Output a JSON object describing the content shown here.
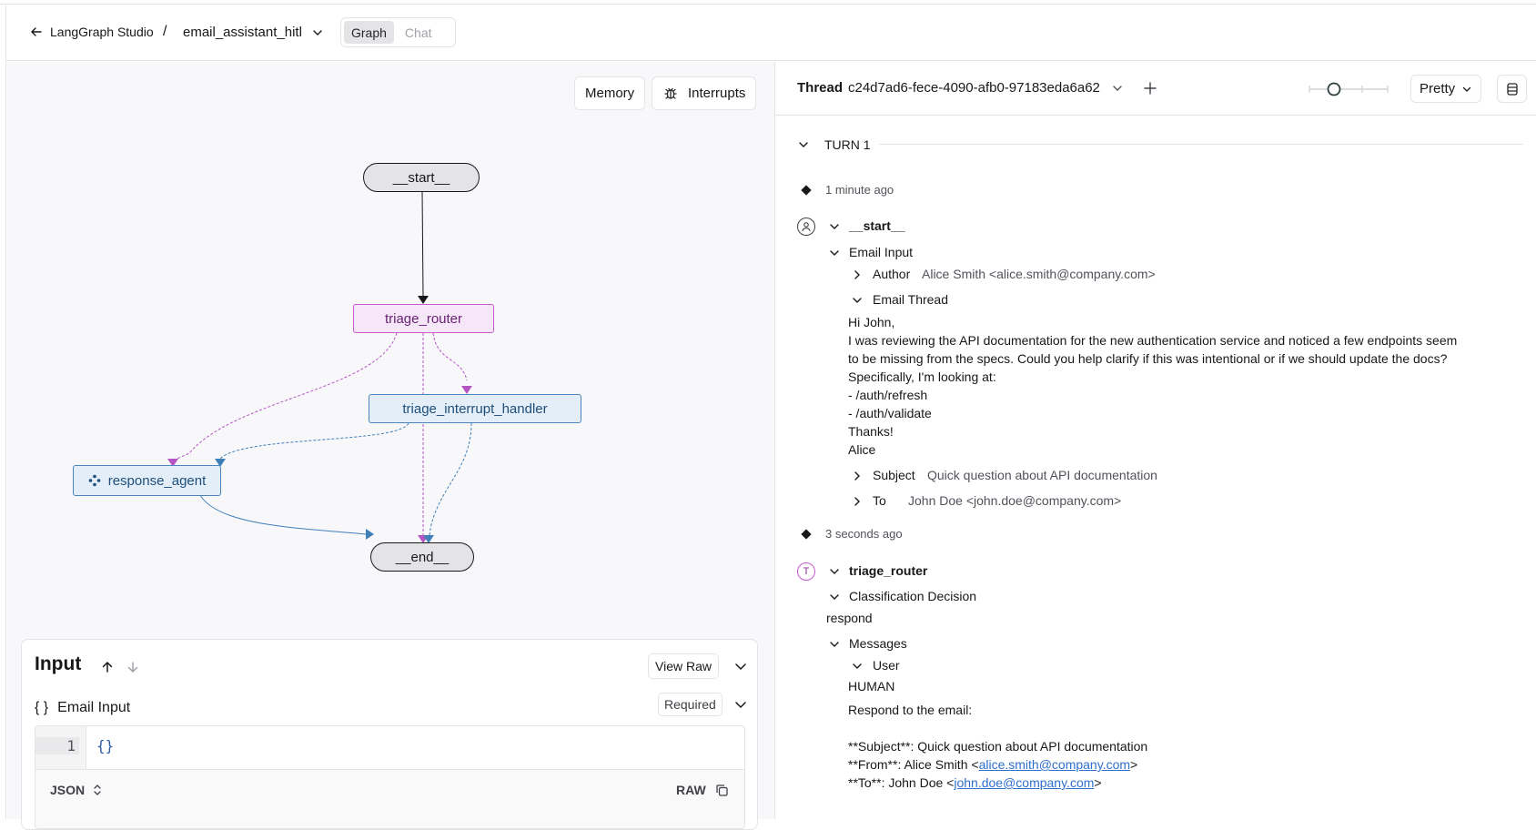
{
  "header": {
    "back_label": "LangGraph Studio",
    "separator": "/",
    "graph_name": "email_assistant_hitl",
    "modes": [
      "Graph",
      "Chat"
    ],
    "active_mode": "Graph"
  },
  "toolbar": {
    "memory_label": "Memory",
    "interrupts_label": "Interrupts"
  },
  "graph": {
    "nodes": {
      "start": "__start__",
      "triage_router": "triage_router",
      "triage_interrupt_handler": "triage_interrupt_handler",
      "response_agent": "response_agent",
      "end": "__end__"
    },
    "colors": {
      "router_edge": "#b455c4",
      "handler_edge": "#3f7fb8",
      "default_edge": "#18181b"
    }
  },
  "input_panel": {
    "title": "Input",
    "view_raw_label": "View Raw",
    "section_label": "Email Input",
    "section_icon": "{ }",
    "required_label": "Required",
    "line_number": "1",
    "code": "{}",
    "format_label": "JSON",
    "raw_label": "RAW"
  },
  "thread": {
    "label": "Thread",
    "id": "c24d7ad6-fece-4090-afb0-97183eda6a62",
    "view_mode": "Pretty",
    "slider_level": 0.3
  },
  "trace": {
    "turn_label": "TURN 1",
    "step1": {
      "time": "1 minute ago",
      "node": "__start__",
      "section": "Email Input",
      "author_key": "Author",
      "author_value": "Alice Smith <alice.smith@company.com>",
      "thread_key": "Email Thread",
      "email_lines": [
        "Hi John,",
        "I was reviewing the API documentation for the new authentication service and noticed a few endpoints seem",
        "to be missing from the specs. Could you help clarify if this was intentional or if we should update the docs?",
        "Specifically, I'm looking at:",
        "- /auth/refresh",
        "- /auth/validate",
        "Thanks!",
        "Alice"
      ],
      "subject_key": "Subject",
      "subject_value": "Quick question about API documentation",
      "to_key": "To",
      "to_value": "John Doe <john.doe@company.com>"
    },
    "step2": {
      "time": "3 seconds ago",
      "node": "triage_router",
      "avatar_letter": "T",
      "classification_key": "Classification Decision",
      "classification_value": "respond",
      "messages_key": "Messages",
      "user_key": "User",
      "role": "HUMAN",
      "line_respond": "Respond to the email:",
      "subject_prefix": "**Subject**: Quick question about API documentation",
      "from_prefix": "**From**: Alice Smith <",
      "from_email": "alice.smith@company.com",
      "from_suffix": ">",
      "to_prefix": "**To**: John Doe <",
      "to_email": "john.doe@company.com",
      "to_suffix": ">"
    }
  }
}
